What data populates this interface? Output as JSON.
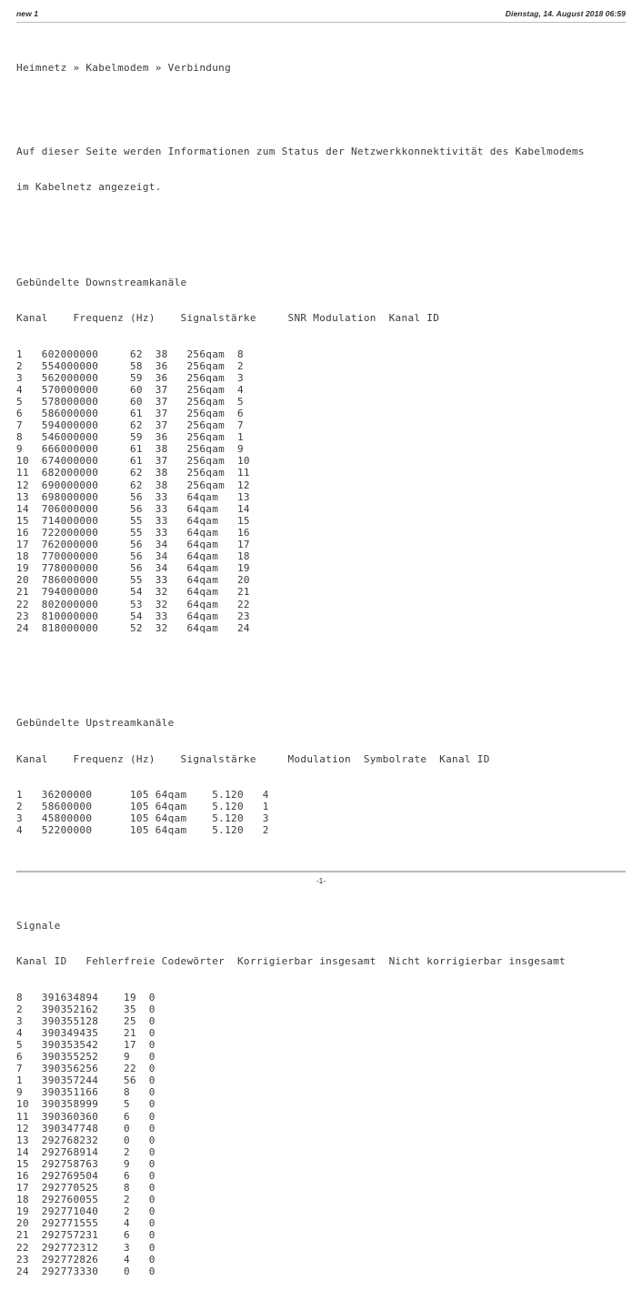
{
  "header": {
    "document_label": "new 1",
    "timestamp": "Dienstag, 14. August 2018 06:59"
  },
  "breadcrumb": "Heimnetz » Kabelmodem » Verbindung",
  "intro": {
    "line1": "Auf dieser Seite werden Informationen zum Status der Netzwerkkonnektivität des Kabelmodems",
    "line2": "im Kabelnetz angezeigt."
  },
  "downstream": {
    "title": "Gebündelte Downstreamkanäle",
    "header": "Kanal    Frequenz (Hz)    Signalstärke     SNR Modulation  Kanal ID",
    "columns": [
      "Kanal",
      "Frequenz (Hz)",
      "Signalstärke",
      "SNR",
      "Modulation",
      "Kanal ID"
    ],
    "rows": [
      "1   602000000     62  38   256qam  8",
      "2   554000000     58  36   256qam  2",
      "3   562000000     59  36   256qam  3",
      "4   570000000     60  37   256qam  4",
      "5   578000000     60  37   256qam  5",
      "6   586000000     61  37   256qam  6",
      "7   594000000     62  37   256qam  7",
      "8   546000000     59  36   256qam  1",
      "9   666000000     61  38   256qam  9",
      "10  674000000     61  37   256qam  10",
      "11  682000000     62  38   256qam  11",
      "12  690000000     62  38   256qam  12",
      "13  698000000     56  33   64qam   13",
      "14  706000000     56  33   64qam   14",
      "15  714000000     55  33   64qam   15",
      "16  722000000     55  33   64qam   16",
      "17  762000000     56  34   64qam   17",
      "18  770000000     56  34   64qam   18",
      "19  778000000     56  34   64qam   19",
      "20  786000000     55  33   64qam   20",
      "21  794000000     54  32   64qam   21",
      "22  802000000     53  32   64qam   22",
      "23  810000000     54  33   64qam   23",
      "24  818000000     52  32   64qam   24"
    ],
    "data": [
      {
        "kanal": "1",
        "frequenz": "602000000",
        "signalstaerke": "62",
        "snr": "38",
        "modulation": "256qam",
        "kanal_id": "8"
      },
      {
        "kanal": "2",
        "frequenz": "554000000",
        "signalstaerke": "58",
        "snr": "36",
        "modulation": "256qam",
        "kanal_id": "2"
      },
      {
        "kanal": "3",
        "frequenz": "562000000",
        "signalstaerke": "59",
        "snr": "36",
        "modulation": "256qam",
        "kanal_id": "3"
      },
      {
        "kanal": "4",
        "frequenz": "570000000",
        "signalstaerke": "60",
        "snr": "37",
        "modulation": "256qam",
        "kanal_id": "4"
      },
      {
        "kanal": "5",
        "frequenz": "578000000",
        "signalstaerke": "60",
        "snr": "37",
        "modulation": "256qam",
        "kanal_id": "5"
      },
      {
        "kanal": "6",
        "frequenz": "586000000",
        "signalstaerke": "61",
        "snr": "37",
        "modulation": "256qam",
        "kanal_id": "6"
      },
      {
        "kanal": "7",
        "frequenz": "594000000",
        "signalstaerke": "62",
        "snr": "37",
        "modulation": "256qam",
        "kanal_id": "7"
      },
      {
        "kanal": "8",
        "frequenz": "546000000",
        "signalstaerke": "59",
        "snr": "36",
        "modulation": "256qam",
        "kanal_id": "1"
      },
      {
        "kanal": "9",
        "frequenz": "666000000",
        "signalstaerke": "61",
        "snr": "38",
        "modulation": "256qam",
        "kanal_id": "9"
      },
      {
        "kanal": "10",
        "frequenz": "674000000",
        "signalstaerke": "61",
        "snr": "37",
        "modulation": "256qam",
        "kanal_id": "10"
      },
      {
        "kanal": "11",
        "frequenz": "682000000",
        "signalstaerke": "62",
        "snr": "38",
        "modulation": "256qam",
        "kanal_id": "11"
      },
      {
        "kanal": "12",
        "frequenz": "690000000",
        "signalstaerke": "62",
        "snr": "38",
        "modulation": "256qam",
        "kanal_id": "12"
      },
      {
        "kanal": "13",
        "frequenz": "698000000",
        "signalstaerke": "56",
        "snr": "33",
        "modulation": "64qam",
        "kanal_id": "13"
      },
      {
        "kanal": "14",
        "frequenz": "706000000",
        "signalstaerke": "56",
        "snr": "33",
        "modulation": "64qam",
        "kanal_id": "14"
      },
      {
        "kanal": "15",
        "frequenz": "714000000",
        "signalstaerke": "55",
        "snr": "33",
        "modulation": "64qam",
        "kanal_id": "15"
      },
      {
        "kanal": "16",
        "frequenz": "722000000",
        "signalstaerke": "55",
        "snr": "33",
        "modulation": "64qam",
        "kanal_id": "16"
      },
      {
        "kanal": "17",
        "frequenz": "762000000",
        "signalstaerke": "56",
        "snr": "34",
        "modulation": "64qam",
        "kanal_id": "17"
      },
      {
        "kanal": "18",
        "frequenz": "770000000",
        "signalstaerke": "56",
        "snr": "34",
        "modulation": "64qam",
        "kanal_id": "18"
      },
      {
        "kanal": "19",
        "frequenz": "778000000",
        "signalstaerke": "56",
        "snr": "34",
        "modulation": "64qam",
        "kanal_id": "19"
      },
      {
        "kanal": "20",
        "frequenz": "786000000",
        "signalstaerke": "55",
        "snr": "33",
        "modulation": "64qam",
        "kanal_id": "20"
      },
      {
        "kanal": "21",
        "frequenz": "794000000",
        "signalstaerke": "54",
        "snr": "32",
        "modulation": "64qam",
        "kanal_id": "21"
      },
      {
        "kanal": "22",
        "frequenz": "802000000",
        "signalstaerke": "53",
        "snr": "32",
        "modulation": "64qam",
        "kanal_id": "22"
      },
      {
        "kanal": "23",
        "frequenz": "810000000",
        "signalstaerke": "54",
        "snr": "33",
        "modulation": "64qam",
        "kanal_id": "23"
      },
      {
        "kanal": "24",
        "frequenz": "818000000",
        "signalstaerke": "52",
        "snr": "32",
        "modulation": "64qam",
        "kanal_id": "24"
      }
    ]
  },
  "upstream": {
    "title": "Gebündelte Upstreamkanäle",
    "header": "Kanal    Frequenz (Hz)    Signalstärke     Modulation  Symbolrate  Kanal ID",
    "columns": [
      "Kanal",
      "Frequenz (Hz)",
      "Signalstärke",
      "Modulation",
      "Symbolrate",
      "Kanal ID"
    ],
    "rows": [
      "1   36200000      105 64qam    5.120   4",
      "2   58600000      105 64qam    5.120   1",
      "3   45800000      105 64qam    5.120   3",
      "4   52200000      105 64qam    5.120   2"
    ],
    "data": [
      {
        "kanal": "1",
        "frequenz": "36200000",
        "signalstaerke": "105",
        "modulation": "64qam",
        "symbolrate": "5.120",
        "kanal_id": "4"
      },
      {
        "kanal": "2",
        "frequenz": "58600000",
        "signalstaerke": "105",
        "modulation": "64qam",
        "symbolrate": "5.120",
        "kanal_id": "1"
      },
      {
        "kanal": "3",
        "frequenz": "45800000",
        "signalstaerke": "105",
        "modulation": "64qam",
        "symbolrate": "5.120",
        "kanal_id": "3"
      },
      {
        "kanal": "4",
        "frequenz": "52200000",
        "signalstaerke": "105",
        "modulation": "64qam",
        "symbolrate": "5.120",
        "kanal_id": "2"
      }
    ]
  },
  "signale": {
    "title": "Signale",
    "header": "Kanal ID   Fehlerfreie Codewörter  Korrigierbar insgesamt  Nicht korrigierbar insgesamt",
    "columns": [
      "Kanal ID",
      "Fehlerfreie Codewörter",
      "Korrigierbar insgesamt",
      "Nicht korrigierbar insgesamt"
    ],
    "rows": [
      "8   391634894    19  0",
      "2   390352162    35  0",
      "3   390355128    25  0",
      "4   390349435    21  0",
      "5   390353542    17  0",
      "6   390355252    9   0",
      "7   390356256    22  0",
      "1   390357244    56  0",
      "9   390351166    8   0",
      "10  390358999    5   0",
      "11  390360360    6   0",
      "12  390347748    0   0",
      "13  292768232    0   0",
      "14  292768914    2   0",
      "15  292758763    9   0",
      "16  292769504    6   0",
      "17  292770525    8   0",
      "18  292760055    2   0",
      "19  292771040    2   0",
      "20  292771555    4   0",
      "21  292757231    6   0",
      "22  292772312    3   0",
      "23  292772826    4   0",
      "24  292773330    0   0"
    ],
    "data": [
      {
        "kanal_id": "8",
        "fehlerfreie": "391634894",
        "korrigierbar": "19",
        "nicht_korrigierbar": "0"
      },
      {
        "kanal_id": "2",
        "fehlerfreie": "390352162",
        "korrigierbar": "35",
        "nicht_korrigierbar": "0"
      },
      {
        "kanal_id": "3",
        "fehlerfreie": "390355128",
        "korrigierbar": "25",
        "nicht_korrigierbar": "0"
      },
      {
        "kanal_id": "4",
        "fehlerfreie": "390349435",
        "korrigierbar": "21",
        "nicht_korrigierbar": "0"
      },
      {
        "kanal_id": "5",
        "fehlerfreie": "390353542",
        "korrigierbar": "17",
        "nicht_korrigierbar": "0"
      },
      {
        "kanal_id": "6",
        "fehlerfreie": "390355252",
        "korrigierbar": "9",
        "nicht_korrigierbar": "0"
      },
      {
        "kanal_id": "7",
        "fehlerfreie": "390356256",
        "korrigierbar": "22",
        "nicht_korrigierbar": "0"
      },
      {
        "kanal_id": "1",
        "fehlerfreie": "390357244",
        "korrigierbar": "56",
        "nicht_korrigierbar": "0"
      },
      {
        "kanal_id": "9",
        "fehlerfreie": "390351166",
        "korrigierbar": "8",
        "nicht_korrigierbar": "0"
      },
      {
        "kanal_id": "10",
        "fehlerfreie": "390358999",
        "korrigierbar": "5",
        "nicht_korrigierbar": "0"
      },
      {
        "kanal_id": "11",
        "fehlerfreie": "390360360",
        "korrigierbar": "6",
        "nicht_korrigierbar": "0"
      },
      {
        "kanal_id": "12",
        "fehlerfreie": "390347748",
        "korrigierbar": "0",
        "nicht_korrigierbar": "0"
      },
      {
        "kanal_id": "13",
        "fehlerfreie": "292768232",
        "korrigierbar": "0",
        "nicht_korrigierbar": "0"
      },
      {
        "kanal_id": "14",
        "fehlerfreie": "292768914",
        "korrigierbar": "2",
        "nicht_korrigierbar": "0"
      },
      {
        "kanal_id": "15",
        "fehlerfreie": "292758763",
        "korrigierbar": "9",
        "nicht_korrigierbar": "0"
      },
      {
        "kanal_id": "16",
        "fehlerfreie": "292769504",
        "korrigierbar": "6",
        "nicht_korrigierbar": "0"
      },
      {
        "kanal_id": "17",
        "fehlerfreie": "292770525",
        "korrigierbar": "8",
        "nicht_korrigierbar": "0"
      },
      {
        "kanal_id": "18",
        "fehlerfreie": "292760055",
        "korrigierbar": "2",
        "nicht_korrigierbar": "0"
      },
      {
        "kanal_id": "19",
        "fehlerfreie": "292771040",
        "korrigierbar": "2",
        "nicht_korrigierbar": "0"
      },
      {
        "kanal_id": "20",
        "fehlerfreie": "292771555",
        "korrigierbar": "4",
        "nicht_korrigierbar": "0"
      },
      {
        "kanal_id": "21",
        "fehlerfreie": "292757231",
        "korrigierbar": "6",
        "nicht_korrigierbar": "0"
      },
      {
        "kanal_id": "22",
        "fehlerfreie": "292772312",
        "korrigierbar": "3",
        "nicht_korrigierbar": "0"
      },
      {
        "kanal_id": "23",
        "fehlerfreie": "292772826",
        "korrigierbar": "4",
        "nicht_korrigierbar": "0"
      },
      {
        "kanal_id": "24",
        "fehlerfreie": "292773330",
        "korrigierbar": "0",
        "nicht_korrigierbar": "0"
      }
    ]
  },
  "footer": {
    "page_number": "-1-"
  }
}
